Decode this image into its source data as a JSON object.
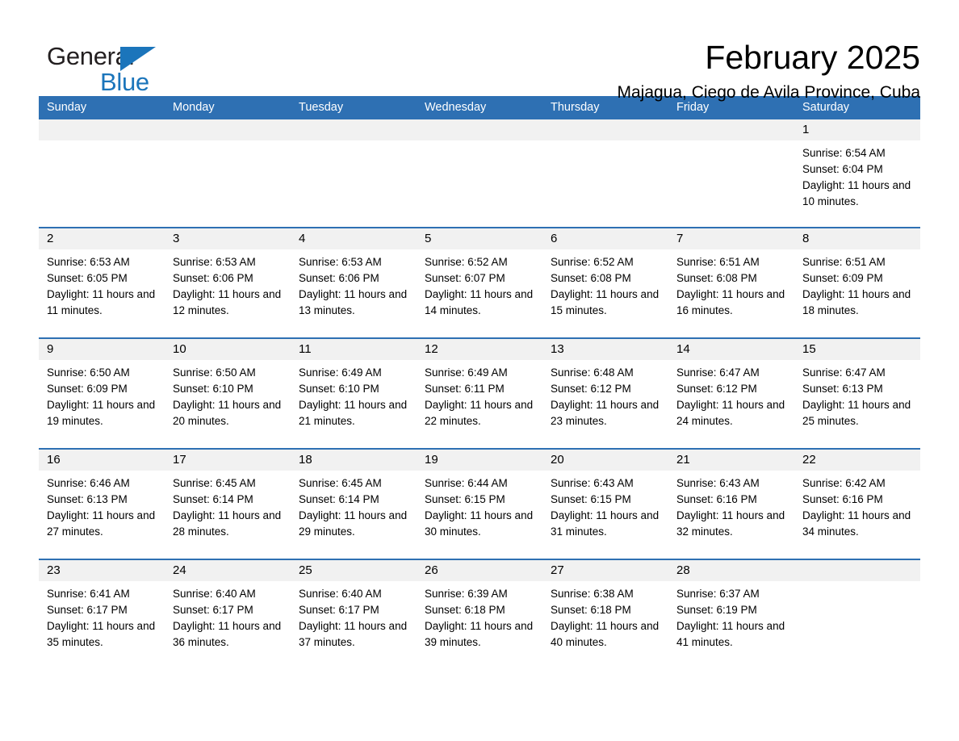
{
  "brand": {
    "word_one": "General",
    "word_two": "Blue",
    "triangle_color": "#1b75bb",
    "text_color": "#231f20"
  },
  "header": {
    "title": "February 2025",
    "subtitle": "Majagua, Ciego de Avila Province, Cuba"
  },
  "colors": {
    "header_blue": "#2e70b3",
    "day_band_gray": "#f1f1f1",
    "brand_blue": "#1b75bb"
  },
  "calendar": {
    "weekdays": [
      "Sunday",
      "Monday",
      "Tuesday",
      "Wednesday",
      "Thursday",
      "Friday",
      "Saturday"
    ],
    "weeks": [
      [
        {
          "day": "",
          "empty": true
        },
        {
          "day": "",
          "empty": true
        },
        {
          "day": "",
          "empty": true
        },
        {
          "day": "",
          "empty": true
        },
        {
          "day": "",
          "empty": true
        },
        {
          "day": "",
          "empty": true
        },
        {
          "day": "1",
          "sunrise": "Sunrise: 6:54 AM",
          "sunset": "Sunset: 6:04 PM",
          "daylight": "Daylight: 11 hours and 10 minutes."
        }
      ],
      [
        {
          "day": "2",
          "sunrise": "Sunrise: 6:53 AM",
          "sunset": "Sunset: 6:05 PM",
          "daylight": "Daylight: 11 hours and 11 minutes."
        },
        {
          "day": "3",
          "sunrise": "Sunrise: 6:53 AM",
          "sunset": "Sunset: 6:06 PM",
          "daylight": "Daylight: 11 hours and 12 minutes."
        },
        {
          "day": "4",
          "sunrise": "Sunrise: 6:53 AM",
          "sunset": "Sunset: 6:06 PM",
          "daylight": "Daylight: 11 hours and 13 minutes."
        },
        {
          "day": "5",
          "sunrise": "Sunrise: 6:52 AM",
          "sunset": "Sunset: 6:07 PM",
          "daylight": "Daylight: 11 hours and 14 minutes."
        },
        {
          "day": "6",
          "sunrise": "Sunrise: 6:52 AM",
          "sunset": "Sunset: 6:08 PM",
          "daylight": "Daylight: 11 hours and 15 minutes."
        },
        {
          "day": "7",
          "sunrise": "Sunrise: 6:51 AM",
          "sunset": "Sunset: 6:08 PM",
          "daylight": "Daylight: 11 hours and 16 minutes."
        },
        {
          "day": "8",
          "sunrise": "Sunrise: 6:51 AM",
          "sunset": "Sunset: 6:09 PM",
          "daylight": "Daylight: 11 hours and 18 minutes."
        }
      ],
      [
        {
          "day": "9",
          "sunrise": "Sunrise: 6:50 AM",
          "sunset": "Sunset: 6:09 PM",
          "daylight": "Daylight: 11 hours and 19 minutes."
        },
        {
          "day": "10",
          "sunrise": "Sunrise: 6:50 AM",
          "sunset": "Sunset: 6:10 PM",
          "daylight": "Daylight: 11 hours and 20 minutes."
        },
        {
          "day": "11",
          "sunrise": "Sunrise: 6:49 AM",
          "sunset": "Sunset: 6:10 PM",
          "daylight": "Daylight: 11 hours and 21 minutes."
        },
        {
          "day": "12",
          "sunrise": "Sunrise: 6:49 AM",
          "sunset": "Sunset: 6:11 PM",
          "daylight": "Daylight: 11 hours and 22 minutes."
        },
        {
          "day": "13",
          "sunrise": "Sunrise: 6:48 AM",
          "sunset": "Sunset: 6:12 PM",
          "daylight": "Daylight: 11 hours and 23 minutes."
        },
        {
          "day": "14",
          "sunrise": "Sunrise: 6:47 AM",
          "sunset": "Sunset: 6:12 PM",
          "daylight": "Daylight: 11 hours and 24 minutes."
        },
        {
          "day": "15",
          "sunrise": "Sunrise: 6:47 AM",
          "sunset": "Sunset: 6:13 PM",
          "daylight": "Daylight: 11 hours and 25 minutes."
        }
      ],
      [
        {
          "day": "16",
          "sunrise": "Sunrise: 6:46 AM",
          "sunset": "Sunset: 6:13 PM",
          "daylight": "Daylight: 11 hours and 27 minutes."
        },
        {
          "day": "17",
          "sunrise": "Sunrise: 6:45 AM",
          "sunset": "Sunset: 6:14 PM",
          "daylight": "Daylight: 11 hours and 28 minutes."
        },
        {
          "day": "18",
          "sunrise": "Sunrise: 6:45 AM",
          "sunset": "Sunset: 6:14 PM",
          "daylight": "Daylight: 11 hours and 29 minutes."
        },
        {
          "day": "19",
          "sunrise": "Sunrise: 6:44 AM",
          "sunset": "Sunset: 6:15 PM",
          "daylight": "Daylight: 11 hours and 30 minutes."
        },
        {
          "day": "20",
          "sunrise": "Sunrise: 6:43 AM",
          "sunset": "Sunset: 6:15 PM",
          "daylight": "Daylight: 11 hours and 31 minutes."
        },
        {
          "day": "21",
          "sunrise": "Sunrise: 6:43 AM",
          "sunset": "Sunset: 6:16 PM",
          "daylight": "Daylight: 11 hours and 32 minutes."
        },
        {
          "day": "22",
          "sunrise": "Sunrise: 6:42 AM",
          "sunset": "Sunset: 6:16 PM",
          "daylight": "Daylight: 11 hours and 34 minutes."
        }
      ],
      [
        {
          "day": "23",
          "sunrise": "Sunrise: 6:41 AM",
          "sunset": "Sunset: 6:17 PM",
          "daylight": "Daylight: 11 hours and 35 minutes."
        },
        {
          "day": "24",
          "sunrise": "Sunrise: 6:40 AM",
          "sunset": "Sunset: 6:17 PM",
          "daylight": "Daylight: 11 hours and 36 minutes."
        },
        {
          "day": "25",
          "sunrise": "Sunrise: 6:40 AM",
          "sunset": "Sunset: 6:17 PM",
          "daylight": "Daylight: 11 hours and 37 minutes."
        },
        {
          "day": "26",
          "sunrise": "Sunrise: 6:39 AM",
          "sunset": "Sunset: 6:18 PM",
          "daylight": "Daylight: 11 hours and 39 minutes."
        },
        {
          "day": "27",
          "sunrise": "Sunrise: 6:38 AM",
          "sunset": "Sunset: 6:18 PM",
          "daylight": "Daylight: 11 hours and 40 minutes."
        },
        {
          "day": "28",
          "sunrise": "Sunrise: 6:37 AM",
          "sunset": "Sunset: 6:19 PM",
          "daylight": "Daylight: 11 hours and 41 minutes."
        },
        {
          "day": "",
          "empty": true
        }
      ]
    ]
  }
}
